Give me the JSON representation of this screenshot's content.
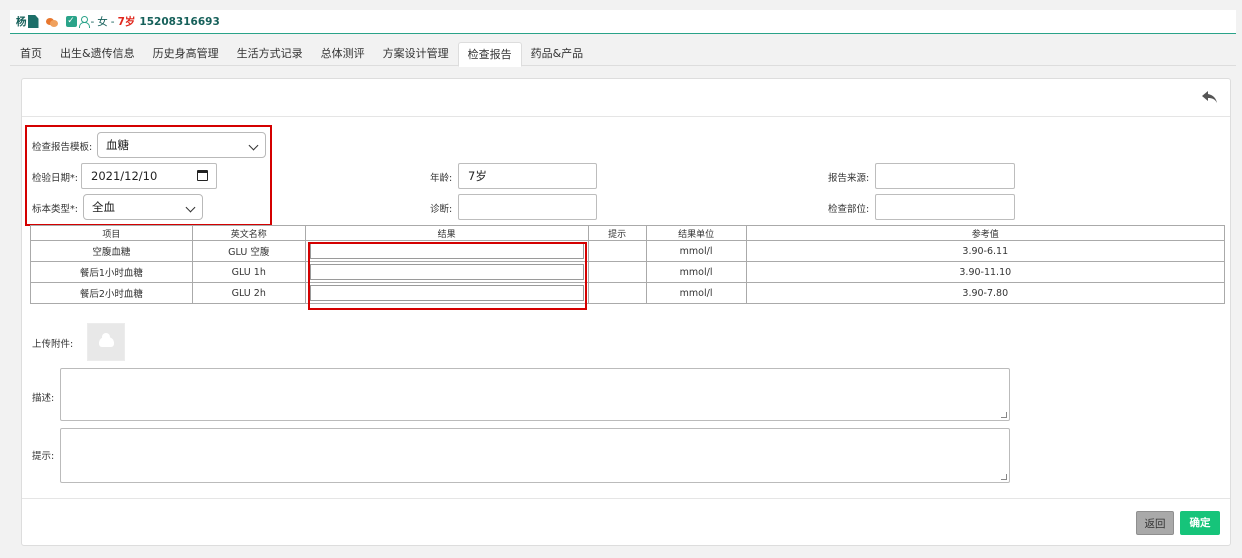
{
  "patient": {
    "name": "杨",
    "gender": "女",
    "age": "7岁",
    "phone": "15208316693",
    "separator": "-"
  },
  "tabs": [
    {
      "label": "首页",
      "active": false
    },
    {
      "label": "出生&遗传信息",
      "active": false
    },
    {
      "label": "历史身高管理",
      "active": false
    },
    {
      "label": "生活方式记录",
      "active": false
    },
    {
      "label": "总体测评",
      "active": false
    },
    {
      "label": "方案设计管理",
      "active": false
    },
    {
      "label": "检查报告",
      "active": true
    },
    {
      "label": "药品&产品",
      "active": false
    }
  ],
  "form": {
    "template_label": "检查报告模板:",
    "template_value": "血糖",
    "date_label": "检验日期*:",
    "date_value": "2021/12/10",
    "sample_label": "标本类型*:",
    "sample_value": "全血",
    "age_label": "年龄:",
    "age_value": "7岁",
    "diagnosis_label": "诊断:",
    "diagnosis_value": "",
    "source_label": "报告来源:",
    "source_value": "",
    "part_label": "检查部位:",
    "part_value": ""
  },
  "table": {
    "headers": [
      "项目",
      "英文名称",
      "结果",
      "提示",
      "结果单位",
      "参考值"
    ],
    "rows": [
      {
        "item": "空腹血糖",
        "en": "GLU 空腹",
        "result": "",
        "hint": "",
        "unit": "mmol/l",
        "ref": "3.90-6.11"
      },
      {
        "item": "餐后1小时血糖",
        "en": "GLU 1h",
        "result": "",
        "hint": "",
        "unit": "mmol/l",
        "ref": "3.90-11.10"
      },
      {
        "item": "餐后2小时血糖",
        "en": "GLU 2h",
        "result": "",
        "hint": "",
        "unit": "mmol/l",
        "ref": "3.90-7.80"
      }
    ]
  },
  "upload_label": "上传附件:",
  "desc_label": "描述:",
  "tip_label": "提示:",
  "buttons": {
    "back": "返回",
    "confirm": "确定"
  },
  "colors": {
    "accent": "#2aa389",
    "confirm": "#16c47a",
    "highlight": "#d40000",
    "age_text": "#e0261c"
  },
  "icons": {
    "doc": "document-icon",
    "chat": "chat-icon",
    "edit": "edit-check-icon",
    "person": "person-icon",
    "back": "reply-back-icon",
    "calendar": "calendar-icon",
    "upload": "cloud-upload-icon"
  }
}
